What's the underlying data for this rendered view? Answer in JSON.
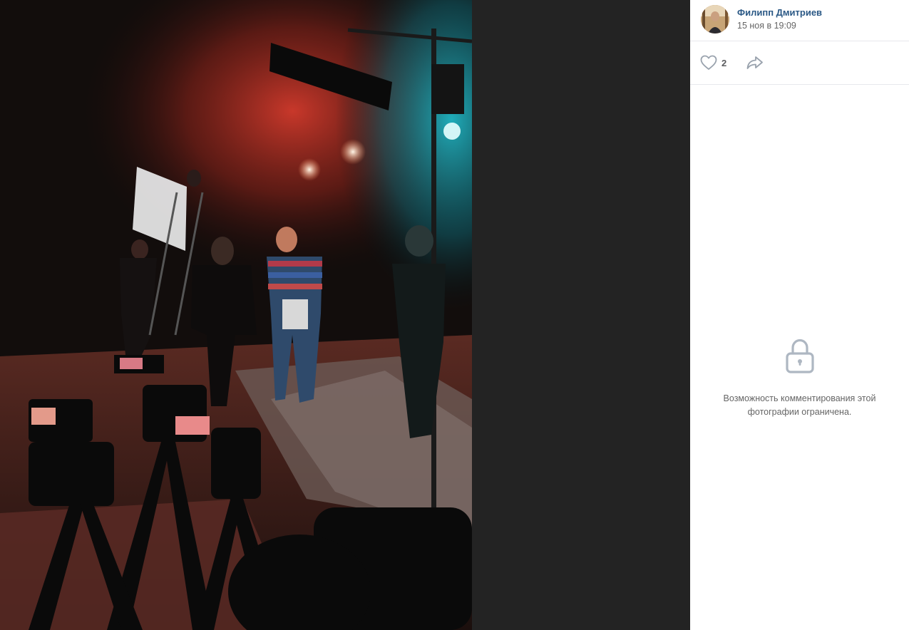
{
  "post": {
    "author": "Филипп Дмитриев",
    "date": "15 ноя в 19:09"
  },
  "actions": {
    "likes": "2",
    "like_icon": "heart-outline-icon",
    "share_icon": "share-arrow-icon"
  },
  "comments": {
    "restricted_message": "Возможность комментирования этой фотографии ограничена.",
    "icon": "lock-icon"
  },
  "colors": {
    "link": "#2a5885",
    "muted": "#656565",
    "icon": "#aeb7c2",
    "viewer_bg": "#232323"
  }
}
